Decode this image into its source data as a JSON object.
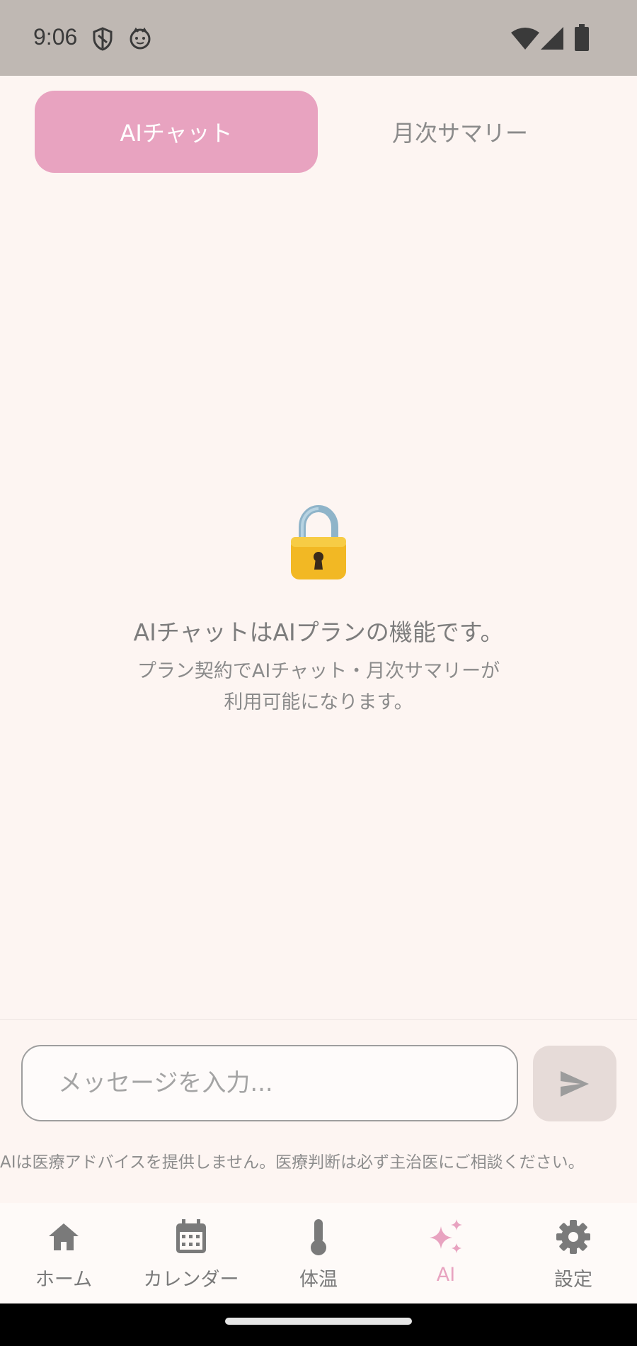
{
  "status_bar": {
    "time": "9:06",
    "icons": [
      "shield-icon",
      "cat-icon",
      "wifi-icon",
      "signal-icon",
      "battery-icon"
    ]
  },
  "tabs": [
    {
      "label": "AIチャット",
      "active": true
    },
    {
      "label": "月次サマリー",
      "active": false
    }
  ],
  "locked": {
    "icon": "lock-icon",
    "title": "AIチャットはAIプランの機能です。",
    "description_line1": "プラン契約でAIチャット・月次サマリーが",
    "description_line2": "利用可能になります。"
  },
  "composer": {
    "placeholder": "メッセージを入力...",
    "send_icon": "send-icon"
  },
  "disclaimer": "AIは医療アドバイスを提供しません。医療判断は必ず主治医にご相談ください。",
  "bottom_nav": {
    "items": [
      {
        "label": "ホーム",
        "icon": "home-icon"
      },
      {
        "label": "カレンダー",
        "icon": "calendar-icon"
      },
      {
        "label": "体温",
        "icon": "thermometer-icon"
      },
      {
        "label": "AI",
        "icon": "sparkle-icon",
        "active": true
      },
      {
        "label": "設定",
        "icon": "gear-icon"
      }
    ]
  },
  "colors": {
    "accent": "#e8a3c0",
    "background": "#fdf5f2",
    "status_bar": "#bfb8b3"
  }
}
